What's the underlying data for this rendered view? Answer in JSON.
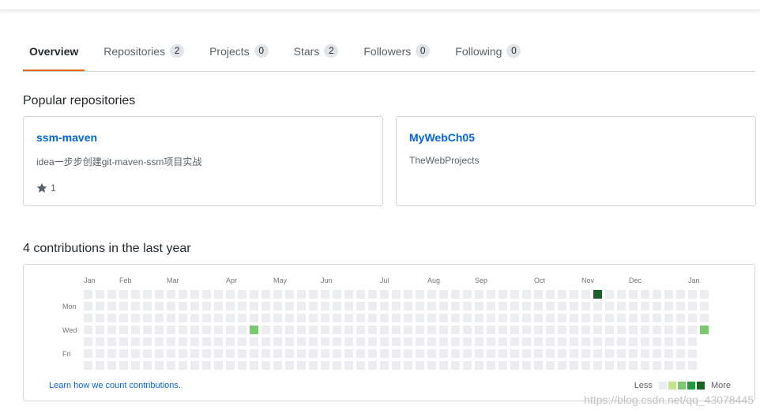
{
  "tabs": [
    {
      "label": "Overview",
      "count": null,
      "active": true
    },
    {
      "label": "Repositories",
      "count": "2"
    },
    {
      "label": "Projects",
      "count": "0"
    },
    {
      "label": "Stars",
      "count": "2"
    },
    {
      "label": "Followers",
      "count": "0"
    },
    {
      "label": "Following",
      "count": "0"
    }
  ],
  "popular": {
    "title": "Popular repositories",
    "repos": [
      {
        "name": "ssm-maven",
        "description": "idea一步步创建git-maven-ssm项目实战",
        "stars": "1"
      },
      {
        "name": "MyWebCh05",
        "description": "TheWebProjects",
        "stars": null
      }
    ]
  },
  "contributions": {
    "title": "4 contributions in the last year",
    "months": [
      "Jan",
      "Feb",
      "Mar",
      "Apr",
      "May",
      "Jun",
      "Jul",
      "Aug",
      "Sep",
      "Oct",
      "Nov",
      "Dec",
      "Jan"
    ],
    "month_weeks": [
      0,
      3,
      7,
      12,
      16,
      20,
      25,
      29,
      33,
      38,
      42,
      46,
      51
    ],
    "day_labels": [
      "Mon",
      "Wed",
      "Fri"
    ],
    "day_label_rows": [
      1,
      3,
      5
    ],
    "weeks": 53,
    "last_week_days": 4,
    "cells": [
      {
        "week": 14,
        "day": 3,
        "level": 2
      },
      {
        "week": 43,
        "day": 0,
        "level": 4
      },
      {
        "week": 52,
        "day": 3,
        "level": 2
      }
    ],
    "learn_link": "Learn how we count contributions.",
    "legend_less": "Less",
    "legend_more": "More",
    "level_colors": [
      "#ebedf0",
      "#c6e48b",
      "#7bc96f",
      "#239a3b",
      "#196127"
    ]
  },
  "watermark": "https://blog.csdn.net/qq_43078445"
}
